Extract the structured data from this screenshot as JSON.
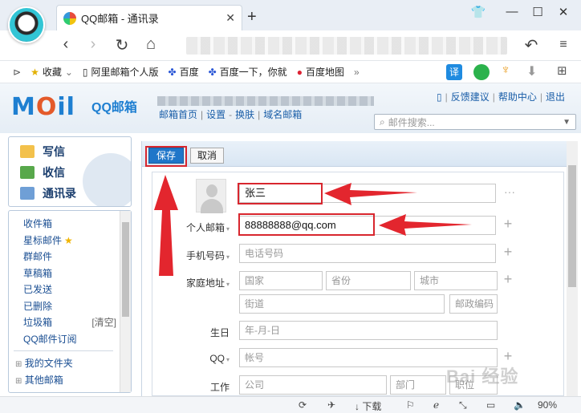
{
  "browser": {
    "tab_title": "QQ邮箱 - 通讯录",
    "tab_close": "✕",
    "new_tab": "+",
    "zoom": "90%",
    "download_label": "下载"
  },
  "bookmarks": [
    {
      "label": "收藏",
      "icon": "star-icon"
    },
    {
      "label": "阿里邮箱个人版",
      "icon": "page-icon"
    },
    {
      "label": "百度",
      "icon": "paw-icon"
    },
    {
      "label": "百度一下，你就",
      "icon": "paw-icon"
    },
    {
      "label": "百度地图",
      "icon": "map-pin-icon"
    }
  ],
  "mail": {
    "brand": "M",
    "brand_accent": "O",
    "brand_rest": "il",
    "brand_cn": "QQ邮箱",
    "links": [
      "邮箱首页",
      "设置",
      "换肤",
      "域名邮箱"
    ],
    "top_links": [
      "反馈建议",
      "帮助中心",
      "退出"
    ],
    "search_placeholder": "邮件搜索..."
  },
  "sidebar": {
    "compose": "写信",
    "inbox": "收信",
    "contacts": "通讯录",
    "folders": [
      "收件箱",
      "星标邮件",
      "群邮件",
      "草稿箱",
      "已发送",
      "已删除",
      "垃圾箱",
      "QQ邮件订阅"
    ],
    "clear_label": "[清空]",
    "groups": [
      "我的文件夹",
      "其他邮箱"
    ]
  },
  "toolbar": {
    "save": "保存",
    "cancel": "取消"
  },
  "form": {
    "name_value": "张三",
    "email_label": "个人邮箱",
    "email_value": "88888888@qq.com",
    "phone_label": "手机号码",
    "phone_placeholder": "电话号码",
    "address_label": "家庭地址",
    "country_placeholder": "国家",
    "province_placeholder": "省份",
    "city_placeholder": "城市",
    "street_placeholder": "街道",
    "zip_placeholder": "邮政编码",
    "birthday_label": "生日",
    "birthday_placeholder": "年-月-日",
    "qq_label": "QQ",
    "qq_placeholder": "帐号",
    "work_label": "工作",
    "company_placeholder": "公司",
    "dept_placeholder": "部门",
    "position_placeholder": "职位"
  },
  "watermark": "Bai 经验",
  "colors": {
    "accent": "#1f76c9",
    "highlight": "#d8262e"
  }
}
